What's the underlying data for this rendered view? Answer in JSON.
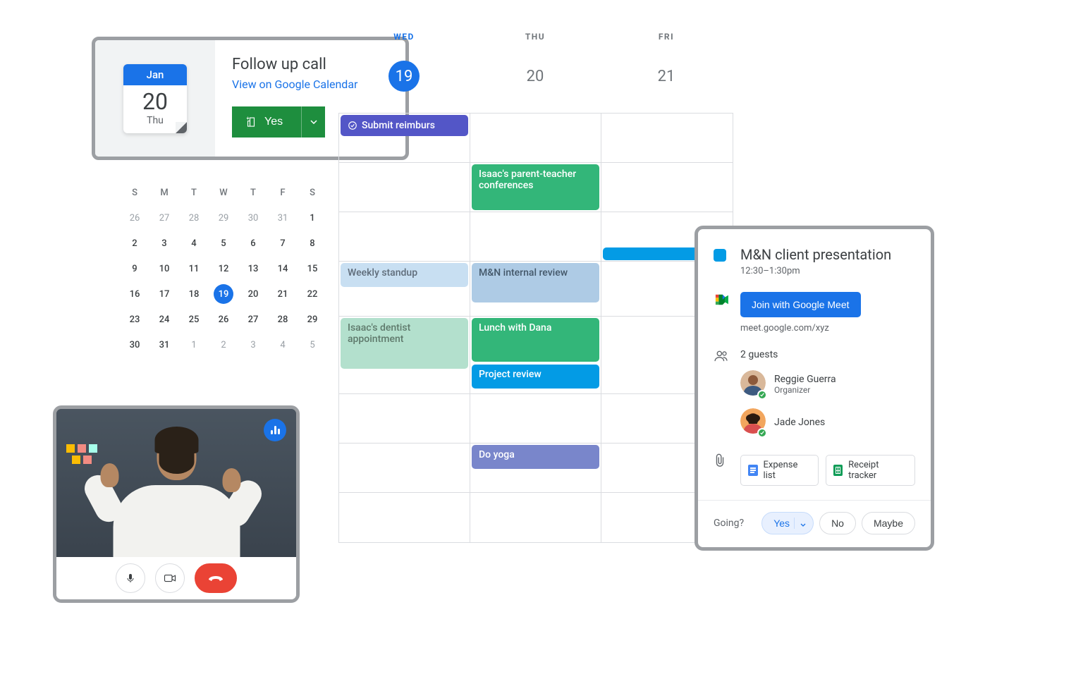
{
  "followup": {
    "month": "Jan",
    "day": "20",
    "dow": "Thu",
    "title": "Follow up call",
    "link": "View on Google Calendar",
    "yes": "Yes"
  },
  "mini_cal": {
    "headers": [
      "S",
      "M",
      "T",
      "W",
      "T",
      "F",
      "S"
    ],
    "rows": [
      [
        {
          "n": "26",
          "dim": true
        },
        {
          "n": "27",
          "dim": true
        },
        {
          "n": "28",
          "dim": true
        },
        {
          "n": "29",
          "dim": true
        },
        {
          "n": "30",
          "dim": true
        },
        {
          "n": "31",
          "dim": true
        },
        {
          "n": "1"
        }
      ],
      [
        {
          "n": "2"
        },
        {
          "n": "3"
        },
        {
          "n": "4"
        },
        {
          "n": "5"
        },
        {
          "n": "6"
        },
        {
          "n": "7"
        },
        {
          "n": "8"
        }
      ],
      [
        {
          "n": "9"
        },
        {
          "n": "10"
        },
        {
          "n": "11"
        },
        {
          "n": "12"
        },
        {
          "n": "13"
        },
        {
          "n": "14"
        },
        {
          "n": "15"
        }
      ],
      [
        {
          "n": "16"
        },
        {
          "n": "17"
        },
        {
          "n": "18"
        },
        {
          "n": "19",
          "today": true
        },
        {
          "n": "20"
        },
        {
          "n": "21"
        },
        {
          "n": "22"
        }
      ],
      [
        {
          "n": "23"
        },
        {
          "n": "24"
        },
        {
          "n": "25"
        },
        {
          "n": "26"
        },
        {
          "n": "27"
        },
        {
          "n": "28"
        },
        {
          "n": "29"
        }
      ],
      [
        {
          "n": "30"
        },
        {
          "n": "31"
        },
        {
          "n": "1",
          "dim": true
        },
        {
          "n": "2",
          "dim": true
        },
        {
          "n": "3",
          "dim": true
        },
        {
          "n": "4",
          "dim": true
        },
        {
          "n": "5",
          "dim": true
        }
      ]
    ]
  },
  "week": {
    "columns": [
      {
        "dow": "WED",
        "date": "19",
        "active": true
      },
      {
        "dow": "THU",
        "date": "20"
      },
      {
        "dow": "FRI",
        "date": "21"
      }
    ],
    "events": {
      "submit": "Submit reimburs",
      "isaac_conf": "Isaac's parent-teacher conferences",
      "standup": "Weekly standup",
      "internal": "M&N internal review",
      "dentist": "Isaac's dentist appointment",
      "lunch": "Lunch with Dana",
      "project": "Project review",
      "yoga": "Do yoga"
    }
  },
  "event_detail": {
    "title": "M&N client presentation",
    "time": "12:30–1:30pm",
    "join": "Join with Google Meet",
    "meet_link": "meet.google.com/xyz",
    "guests_count": "2 guests",
    "guests": [
      {
        "name": "Reggie Guerra",
        "role": "Organizer"
      },
      {
        "name": "Jade Jones",
        "role": ""
      }
    ],
    "attachments": [
      {
        "label": "Expense list",
        "type": "doc"
      },
      {
        "label": "Receipt tracker",
        "type": "sheet"
      }
    ],
    "going": "Going?",
    "rsvp": {
      "yes": "Yes",
      "no": "No",
      "maybe": "Maybe"
    }
  }
}
